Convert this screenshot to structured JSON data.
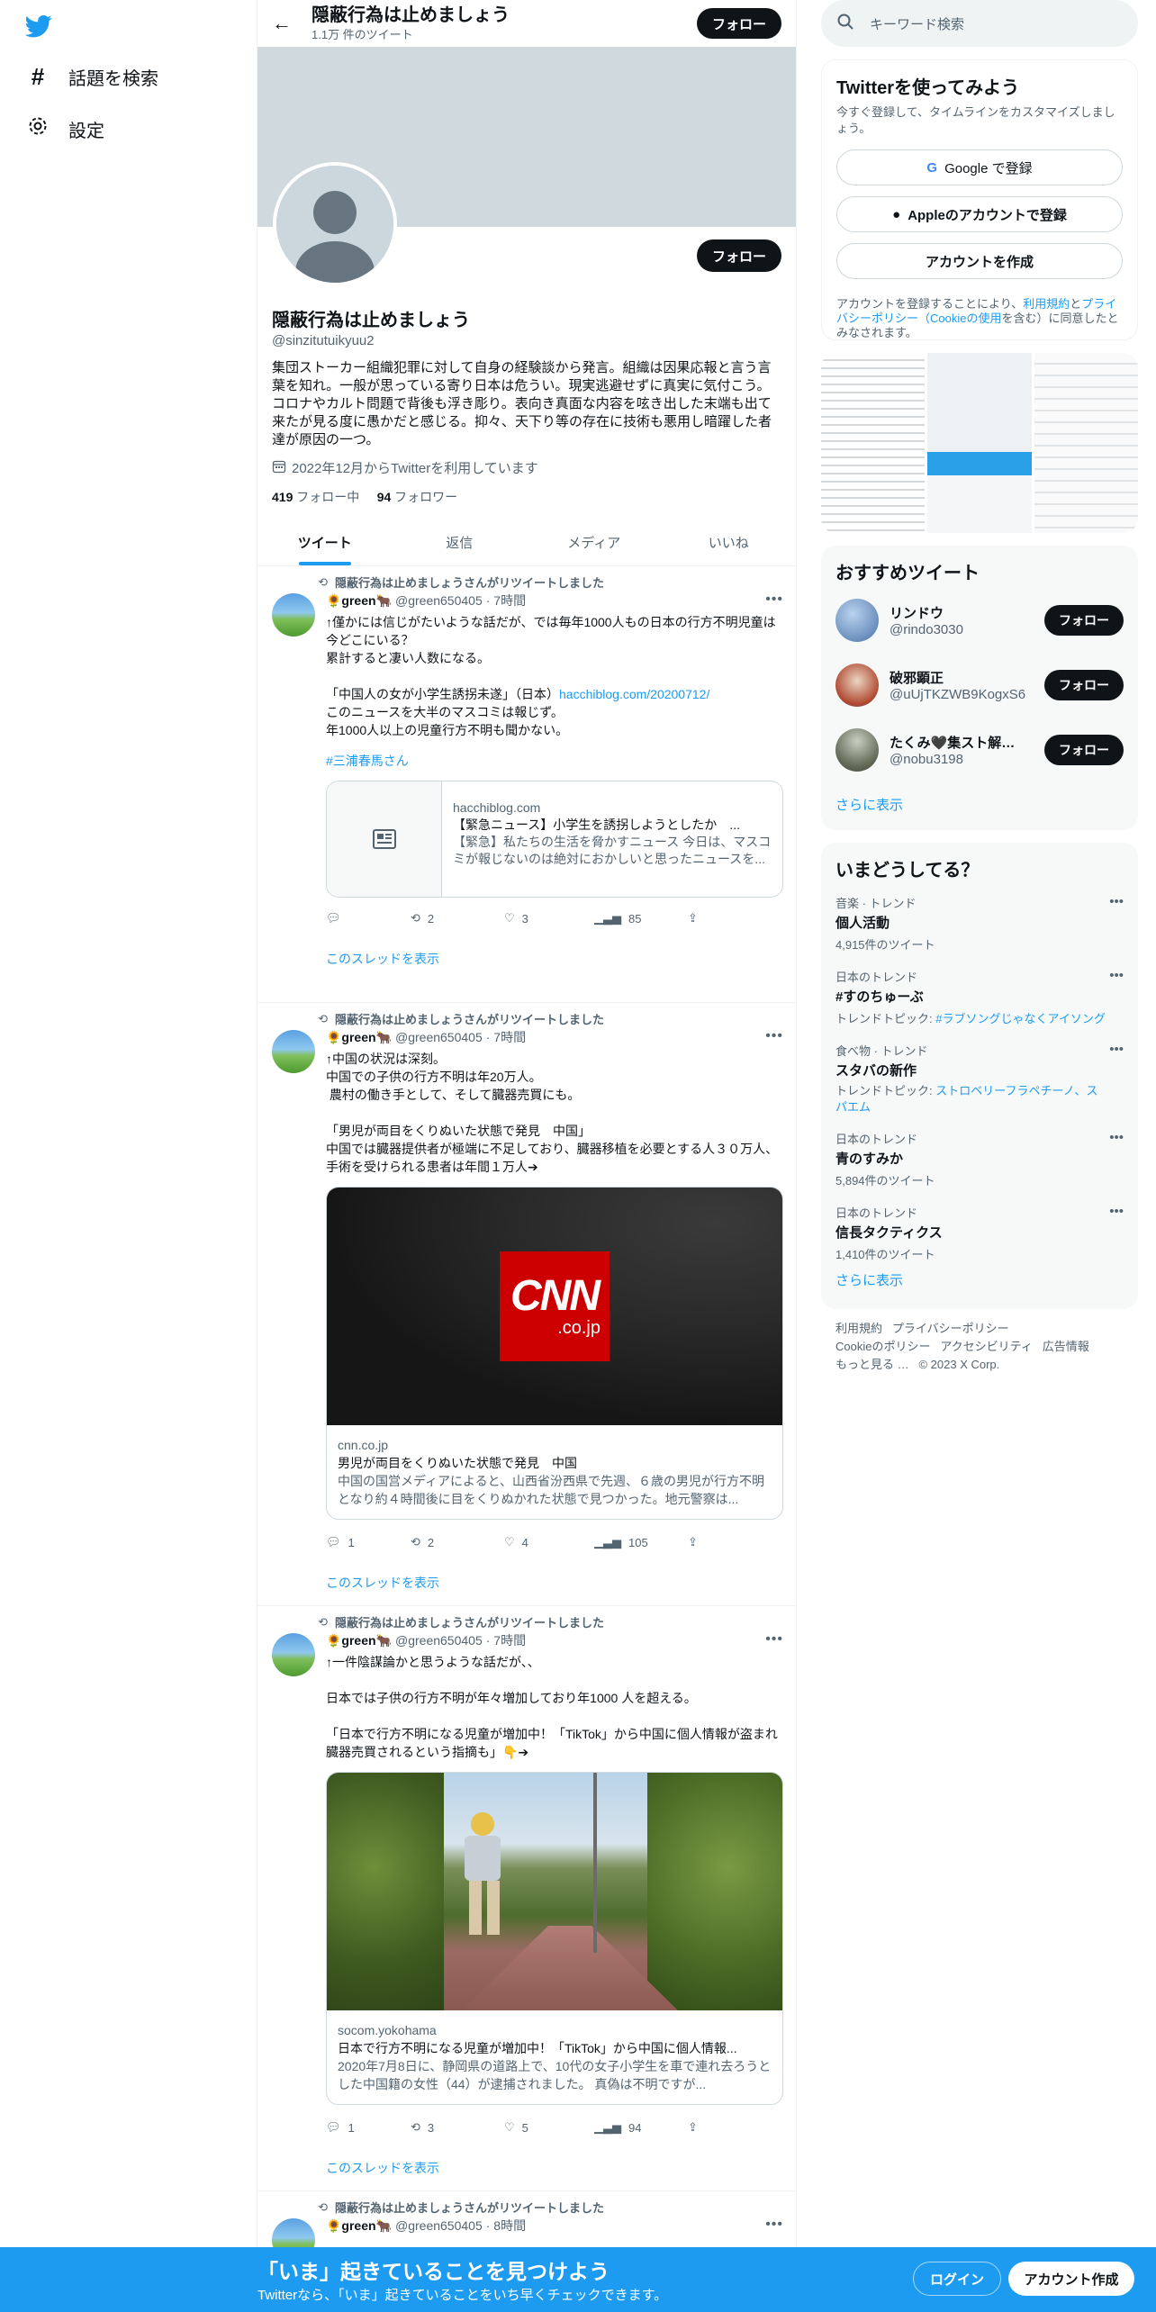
{
  "nav": {
    "explore_label": "話題を検索",
    "settings_label": "設定"
  },
  "header": {
    "title": "隠蔽行為は止めましょう",
    "tweet_count": "1.1万 件のツイート",
    "follow_label": "フォロー"
  },
  "profile": {
    "name": "隠蔽行為は止めましょう",
    "handle": "@sinzitutuikyuu2",
    "bio": "集団ストーカー組織犯罪に対して自身の経験談から発言。組織は因果応報と言う言葉を知れ。一般が思っている寄り日本は危うい。現実逃避せずに真実に気付こう。コロナやカルト問題で背後も浮き彫り。表向き真面な内容を呟き出した末端も出て来たが見る度に愚かだと感じる。抑々、天下り等の存在に技術も悪用し暗躍した者達が原因の一つ。",
    "joined": "2022年12月からTwitterを利用しています",
    "following_count": "419",
    "following_label": "フォロー中",
    "followers_count": "94",
    "followers_label": "フォロワー",
    "follow_label": "フォロー"
  },
  "tabs": [
    "ツイート",
    "返信",
    "メディア",
    "いいね"
  ],
  "tweets": [
    {
      "retweet_note": "隠蔽行為は止めましょうさんがリツイートしました",
      "author": "🌻green🐂",
      "handle": "@green650405",
      "time": "· 7時間",
      "text_before": "↑僅かには信じがたいような話だが、では毎年1000人もの日本の行方不明児童は今どこにいる？\n累計すると凄い人数になる。\n\n「中国人の女が小学生誘拐未遂」（日本）",
      "link": "hacchiblog.com/20200712/",
      "text_after": "\nこのニュースを大半のマスコミは報じず。\n年1000人以上の児童行方不明も聞かない。",
      "hashtag": "#三浦春馬さん",
      "card_domain": "hacchiblog.com",
      "card_title": "【緊急ニュース】小学生を誘拐しようとしたか　...",
      "card_desc": "【緊急】私たちの生活を脅かすニュース 今日は、マスコミが報じないのは絶対におかしいと思ったニュースを...",
      "replies": "",
      "retweets": "2",
      "likes": "3",
      "views": "85",
      "show_thread": "このスレッドを表示"
    },
    {
      "retweet_note": "隠蔽行為は止めましょうさんがリツイートしました",
      "author": "🌻green🐂",
      "handle": "@green650405",
      "time": "· 7時間",
      "text": "↑中国の状況は深刻。\n中国での子供の行方不明は年20万人。\n 農村の働き手として、そして臓器売買にも。\n\n「男児が両目をくりぬいた状態で発見　中国」\n中国では臓器提供者が極端に不足しており、臓器移植を必要とする人３０万人、手術を受けられる患者は年間１万人➔",
      "card_domain": "cnn.co.jp",
      "card_title": "男児が両目をくりぬいた状態で発見　中国",
      "card_desc": "中国の国営メディアによると、山西省汾西県で先週、６歳の男児が行方不明となり約４時間後に目をくりぬかれた状態で見つかった。地元警察は...",
      "logo_main": "CNN",
      "logo_sub": ".co.jp",
      "replies": "1",
      "retweets": "2",
      "likes": "4",
      "views": "105",
      "show_thread": "このスレッドを表示"
    },
    {
      "retweet_note": "隠蔽行為は止めましょうさんがリツイートしました",
      "author": "🌻green🐂",
      "handle": "@green650405",
      "time": "· 7時間",
      "text": "↑一件陰謀論かと思うような話だが、、\n\n日本では子供の行方不明が年々増加しており年1000 人を超える。\n\n「日本で行方不明になる児童が増加中！「TikTok」から中国に個人情報が盗まれ臓器売買されるという指摘も」👇➔",
      "card_domain": "socom.yokohama",
      "card_title": "日本で行方不明になる児童が増加中！「TikTok」から中国に個人情報...",
      "card_desc": "2020年7月8日に、静岡県の道路上で、10代の女子小学生を車で連れ去ろうとした中国籍の女性（44）が逮捕されました。 真偽は不明ですが...",
      "replies": "1",
      "retweets": "3",
      "likes": "5",
      "views": "94",
      "show_thread": "このスレッドを表示"
    },
    {
      "retweet_note": "隠蔽行為は止めましょうさんがリツイートしました",
      "author": "🌻green🐂",
      "handle": "@green650405",
      "time": "· 8時間"
    }
  ],
  "sidebar": {
    "search_placeholder": "キーワード検索",
    "signup": {
      "title": "Twitterを使ってみよう",
      "note": "今すぐ登録して、タイムラインをカスタマイズしましょう。",
      "google_label": "Google で登録",
      "apple_label": "Appleのアカウントで登録",
      "create_label": "アカウントを作成",
      "terms_prefix": "アカウントを登録することにより、",
      "terms_link1": "利用規約",
      "terms_mid": "と",
      "terms_link2": "プライバシーポリシー（Cookieの使用",
      "terms_suffix": "を含む）に同意したとみなされます。"
    },
    "recommended": {
      "title": "おすすめツイート",
      "users": [
        {
          "name": "リンドウ",
          "handle": "@rindo3030",
          "color": "#7a9cc6"
        },
        {
          "name": "破邪顕正",
          "handle": "@uUjTKZWB9KogxS6",
          "color": "#c86a4a"
        },
        {
          "name": "たくみ🖤集スト解決...",
          "handle": "@nobu3198",
          "color": "#8a8f7a"
        }
      ],
      "follow_label": "フォロー",
      "more_label": "さらに表示"
    },
    "trends": {
      "title": "いまどうしてる？",
      "items": [
        {
          "category": "音楽 · トレンド",
          "name": "個人活動",
          "count": "4,915件のツイート"
        },
        {
          "category": "日本のトレンド",
          "name": "#すのちゅーぶ",
          "count": "トレンドトピック: ",
          "link": "#ラブソングじゃなくアイソング"
        },
        {
          "category": "食べ物 · トレンド",
          "name": "スタバの新作",
          "count": "トレンドトピック: ",
          "link": "ストロベリーフラペチーノ、スパエム"
        },
        {
          "category": "日本のトレンド",
          "name": "青のすみか",
          "count": "5,894件のツイート"
        },
        {
          "category": "日本のトレンド",
          "name": "信長タクティクス",
          "count": "1,410件のツイート"
        }
      ],
      "more_label": "さらに表示"
    },
    "footer": [
      "利用規約",
      "プライバシーポリシー",
      "Cookieのポリシー",
      "アクセシビリティ",
      "広告情報",
      "もっと見る …",
      "© 2023 X Corp."
    ]
  },
  "bottom_bar": {
    "title": "「いま」起きていることを見つけよう",
    "subtitle": "Twitterなら、「いま」起きていることをいち早くチェックできます。",
    "login_label": "ログイン",
    "create_label": "アカウント作成"
  },
  "colors": {
    "accent": "#1d9bf0",
    "dark": "#0f1419",
    "muted": "#536471"
  }
}
